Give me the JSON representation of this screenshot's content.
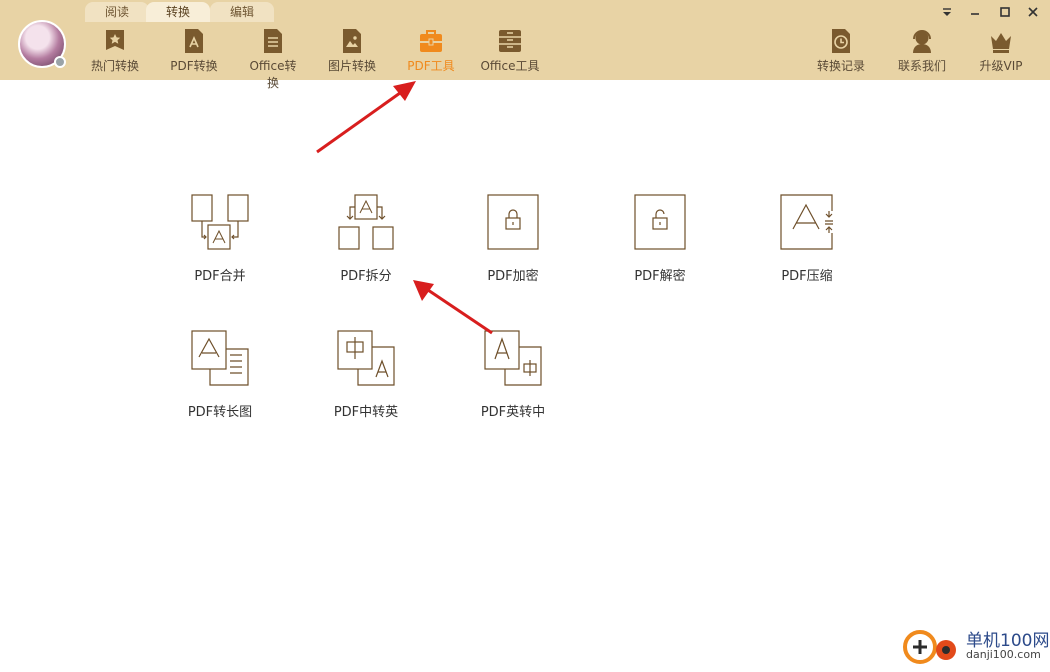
{
  "tabs": [
    "阅读",
    "转换",
    "编辑"
  ],
  "nav": [
    {
      "label": "热门转换",
      "icon": "star-icon"
    },
    {
      "label": "PDF转换",
      "icon": "pdf-icon"
    },
    {
      "label": "Office转换",
      "icon": "document-icon"
    },
    {
      "label": "图片转换",
      "icon": "image-icon"
    },
    {
      "label": "PDF工具",
      "icon": "toolbox-icon"
    },
    {
      "label": "Office工具",
      "icon": "drawer-icon"
    }
  ],
  "right_nav": [
    {
      "label": "转换记录",
      "icon": "history-icon"
    },
    {
      "label": "联系我们",
      "icon": "headset-icon"
    },
    {
      "label": "升级VIP",
      "icon": "crown-icon"
    }
  ],
  "colors": {
    "header": "#e8d3a5",
    "active": "#f08a1d",
    "icon": "#7a5a2e",
    "arrow": "#d81e1e"
  },
  "tools": [
    {
      "label": "PDF合并",
      "icon": "merge-icon"
    },
    {
      "label": "PDF拆分",
      "icon": "split-icon"
    },
    {
      "label": "PDF加密",
      "icon": "lock-icon"
    },
    {
      "label": "PDF解密",
      "icon": "unlock-icon"
    },
    {
      "label": "PDF压缩",
      "icon": "compress-icon"
    },
    {
      "label": "PDF转长图",
      "icon": "long-image-icon"
    },
    {
      "label": "PDF中转英",
      "icon": "zh-to-en-icon"
    },
    {
      "label": "PDF英转中",
      "icon": "en-to-zh-icon"
    }
  ],
  "watermark": {
    "name": "单机100网",
    "url": "danji100.com"
  }
}
